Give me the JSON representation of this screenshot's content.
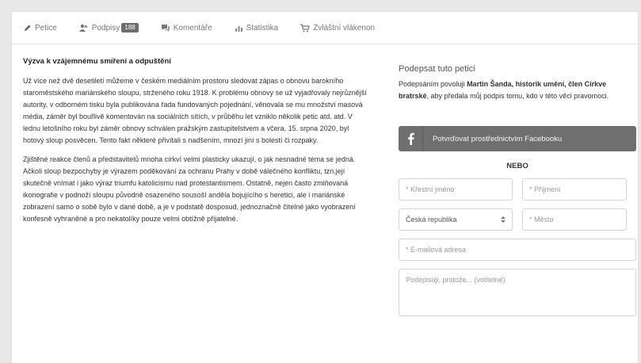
{
  "tabs": [
    {
      "label": "Petice",
      "icon": "pencil-icon"
    },
    {
      "label": "Podpisy",
      "icon": "users-icon",
      "badge": "188"
    },
    {
      "label": "Komentáře",
      "icon": "comments-icon"
    },
    {
      "label": "Statistika",
      "icon": "bar-chart-icon"
    },
    {
      "label": "Zvláštní vlákenon",
      "icon": "cart-icon"
    }
  ],
  "article": {
    "title": "Výzva k vzájemnému smíření a odpuštění",
    "paragraphs": [
      "Už více než dvě desetiletí můžeme v českém mediálním prostoru sledovat zápas o obnovu barokního staroměstského mariánského sloupu, strženého roku 1918. K problému obnovy se už vyjadřovaly nejrůznější autority, v odborném tisku byla publikována řada fundovaných pojednání, věnovala se mu množství masová média, záměr byl bouřlivě komentován na sociálních sítích, v průběhu let vzniklo několik petic atd. atd. V lednu letošního roku byl záměr obnovy schválen pražským zastupitelstvem a včera, 15. srpna 2020, byl hotový sloup posvěcen. Tento fakt některé přivítali s nadšením, mnozí jiní s bolestí či rozpaky.",
      "Zjištěné reakce členů a představitelů mnoha církví velmi plasticky ukazují, o jak nesnadné téma se jedná. Ačkoli sloup bezpochyby je výrazem poděkování za ochranu Prahy v době válečného konfliktu, tzn.její skutečně vnímat i jako výraz triumfu katolicismu nad protestantismem. Ostatně, nejen často zmiňovaná ikonografie v podnoží sloupu původně osazeného sousoší anděla bojujícího s heretici, ale i mariánské zobrazení samo o sobě bylo v dané době, a je v podstatě dosposud, jednoznačně čitelné jako vyobrazení konfesně vyhraněné a pro nekatolíky pouze velmi obtížně přijatelné."
    ]
  },
  "sign": {
    "title": "Podepsat tuto petici",
    "desc_pre": "Podepsáním povoluji ",
    "desc_bold": "Martin Šanda, historik umění, člen Církve bratrské",
    "desc_post": ", aby předala můj podpis tomu, kdo v této věci pravomoci.",
    "facebook_label": "Potvrďovat prostřednictvím Facebooku",
    "or_label": "NEBO",
    "first_name_placeholder": "* Křestní jméno",
    "last_name_placeholder": "* Příjmení",
    "country_value": "Česká republika",
    "city_placeholder": "* Město",
    "email_placeholder": "* E-mailová adresa",
    "comment_placeholder": "Podepisuji, protože... (volitelné)"
  }
}
